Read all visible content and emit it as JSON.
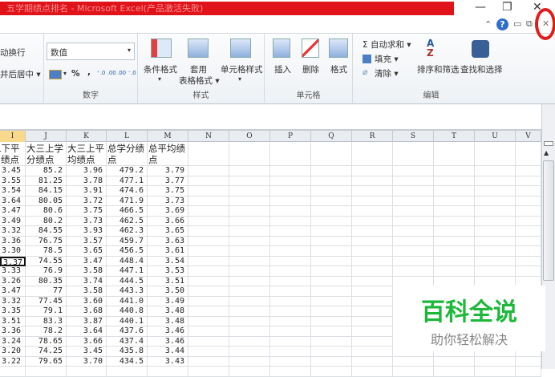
{
  "window": {
    "title": "五学期绩点排名 - Microsoft Excel(产品激活失败)",
    "minimize": "—",
    "restore": "❐",
    "close": "✕"
  },
  "ribbon_controls": {
    "collapse": "⌃",
    "help": "?",
    "min": "▭",
    "restore": "⧉",
    "close": "✕"
  },
  "alignment": {
    "wrap_text": "动换行",
    "merge_center": "并后居中 ▾"
  },
  "number": {
    "format_value": "数值",
    "currency": "▾",
    "percent": "%",
    "comma": ",",
    "inc_dec": "⁺.0 .00",
    "dec_dec": ".00 ⁻.0",
    "label": "数字"
  },
  "styles": {
    "conditional": "条件格式",
    "conditional_arrow": "▾",
    "table_1": "套用",
    "table_2": "表格格式 ▾",
    "cell_styles": "单元格样式",
    "cell_styles_arrow": "▾",
    "label": "样式"
  },
  "cells": {
    "insert": "插入",
    "delete": "删除",
    "format": "格式",
    "arrow": "▾",
    "label": "单元格"
  },
  "editing": {
    "autosum": "Σ 自动求和 ▾",
    "fill": "填充 ▾",
    "clear": "清除 ▾",
    "sort": "排序和筛选",
    "find": "查找和选择",
    "arrow": "▾",
    "label": "编辑"
  },
  "columns": [
    "I",
    "J",
    "K",
    "L",
    "M",
    "N",
    "O",
    "P",
    "Q",
    "R",
    "S",
    "T",
    "U",
    "V"
  ],
  "headers": [
    "二下平绩点",
    "大三上学分绩点",
    "大三上平均绩点",
    "总学分绩点",
    "总平均绩点"
  ],
  "rows": [
    [
      "3.45",
      "85.2",
      "3.96",
      "479.2",
      "3.79"
    ],
    [
      "3.55",
      "81.25",
      "3.78",
      "477.1",
      "3.77"
    ],
    [
      "3.54",
      "84.15",
      "3.91",
      "474.6",
      "3.75"
    ],
    [
      "3.64",
      "80.05",
      "3.72",
      "471.9",
      "3.73"
    ],
    [
      "3.47",
      "80.6",
      "3.75",
      "466.5",
      "3.69"
    ],
    [
      "3.49",
      "80.2",
      "3.73",
      "462.5",
      "3.66"
    ],
    [
      "3.32",
      "84.55",
      "3.93",
      "462.3",
      "3.65"
    ],
    [
      "3.36",
      "76.75",
      "3.57",
      "459.7",
      "3.63"
    ],
    [
      "3.30",
      "78.5",
      "3.65",
      "456.5",
      "3.61"
    ],
    [
      "3.37",
      "74.55",
      "3.47",
      "448.4",
      "3.54"
    ],
    [
      "3.33",
      "76.9",
      "3.58",
      "447.1",
      "3.53"
    ],
    [
      "3.26",
      "80.35",
      "3.74",
      "444.5",
      "3.51"
    ],
    [
      "3.47",
      "77",
      "3.58",
      "443.3",
      "3.50"
    ],
    [
      "3.32",
      "77.45",
      "3.60",
      "441.0",
      "3.49"
    ],
    [
      "3.35",
      "79.1",
      "3.68",
      "440.8",
      "3.48"
    ],
    [
      "3.51",
      "83.3",
      "3.87",
      "440.1",
      "3.48"
    ],
    [
      "3.36",
      "78.2",
      "3.64",
      "437.6",
      "3.46"
    ],
    [
      "3.24",
      "78.65",
      "3.66",
      "437.4",
      "3.46"
    ],
    [
      "3.20",
      "74.25",
      "3.45",
      "435.8",
      "3.44"
    ],
    [
      "3.22",
      "79.65",
      "3.70",
      "434.5",
      "3.43"
    ]
  ],
  "selected_row": 9,
  "watermark": {
    "title": "百科全说",
    "subtitle": "助你轻松解决",
    "color": "#1db83a"
  }
}
